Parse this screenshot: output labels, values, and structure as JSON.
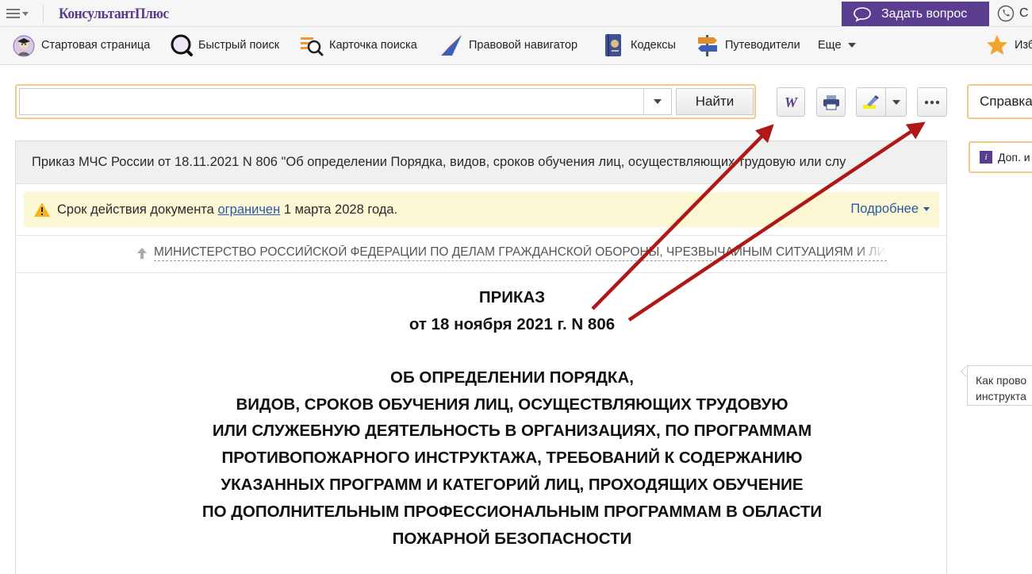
{
  "topbar": {
    "logo": "КонсультантПлюс",
    "ask_button": "Задать вопрос",
    "phone_text": "С"
  },
  "toolbar": {
    "items": [
      {
        "label": "Стартовая страница",
        "icon": "start-page-icon"
      },
      {
        "label": "Быстрый поиск",
        "icon": "quick-search-icon"
      },
      {
        "label": "Карточка поиска",
        "icon": "search-card-icon"
      },
      {
        "label": "Правовой навигатор",
        "icon": "legal-navigator-icon"
      },
      {
        "label": "Кодексы",
        "icon": "codes-icon"
      },
      {
        "label": "Путеводители",
        "icon": "guides-icon"
      },
      {
        "label": "Еще",
        "icon": "chevron-down-icon"
      },
      {
        "label": "Изб",
        "icon": "star-icon"
      }
    ]
  },
  "search": {
    "value": "",
    "find_button": "Найти"
  },
  "right_panel": {
    "reference_button": "Справка",
    "extra_info": "Доп. и",
    "hint_line1": "Как прово",
    "hint_line2": "инструкта"
  },
  "document": {
    "title": "Приказ МЧС России от 18.11.2021 N 806 \"Об определении Порядка, видов, сроков обучения лиц, осуществляющих трудовую или слу",
    "warning_prefix": "Срок действия документа",
    "warning_link": "ограничен",
    "warning_suffix": "1 марта 2028 года.",
    "details_link": "Подробнее",
    "ministry": "МИНИСТЕРСТВО РОССИЙСКОЙ ФЕДЕРАЦИИ ПО ДЕЛАМ ГРАЖДАНСКОЙ ОБОРОНЫ, ЧРЕЗВЫЧАЙНЫМ СИТУАЦИЯМ И ЛИКВИДАЦИИ",
    "order": "ПРИКАЗ",
    "order_date": "от 18 ноября 2021 г. N 806",
    "heading_lines": [
      "ОБ ОПРЕДЕЛЕНИИ ПОРЯДКА,",
      "ВИДОВ, СРОКОВ ОБУЧЕНИЯ ЛИЦ, ОСУЩЕСТВЛЯЮЩИХ ТРУДОВУЮ",
      "ИЛИ СЛУЖЕБНУЮ ДЕЯТЕЛЬНОСТЬ В ОРГАНИЗАЦИЯХ, ПО ПРОГРАММАМ",
      "ПРОТИВОПОЖАРНОГО ИНСТРУКТАЖА, ТРЕБОВАНИЙ К СОДЕРЖАНИЮ",
      "УКАЗАННЫХ ПРОГРАММ И КАТЕГОРИЙ ЛИЦ, ПРОХОДЯЩИХ ОБУЧЕНИЕ",
      "ПО ДОПОЛНИТЕЛЬНЫМ ПРОФЕССИОНАЛЬНЫМ ПРОГРАММАМ В ОБЛАСТИ",
      "ПОЖАРНОЙ БЕЗОПАСНОСТИ"
    ]
  },
  "colors": {
    "brand_purple": "#5b3d8f",
    "highlight_orange": "#f5c98a",
    "warning_bg": "#fcf8d4",
    "link_blue": "#2b58a8",
    "annotation_arrow": "#b01818"
  }
}
